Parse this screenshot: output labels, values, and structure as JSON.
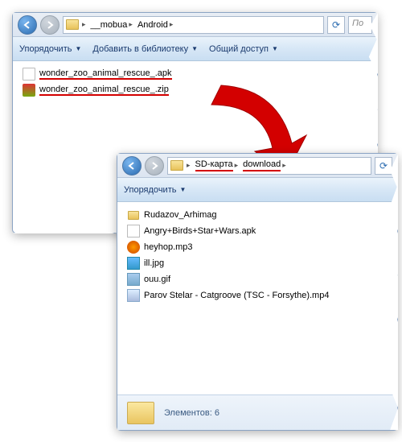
{
  "win1": {
    "breadcrumbs": {
      "a": "__mobua",
      "b": "Android"
    },
    "search_placeholder": "По",
    "toolbar": {
      "organize": "Упорядочить",
      "addlib": "Добавить в библиотеку",
      "share": "Общий доступ"
    },
    "files": {
      "f1": "wonder_zoo_animal_rescue_.apk",
      "f2": "wonder_zoo_animal_rescue_.zip"
    }
  },
  "win2": {
    "breadcrumbs": {
      "a": "SD-карта",
      "b": "download"
    },
    "toolbar": {
      "organize": "Упорядочить"
    },
    "files": {
      "f1": "Rudazov_Arhimag",
      "f2": "Angry+Birds+Star+Wars.apk",
      "f3": "heyhop.mp3",
      "f4": "ill.jpg",
      "f5": "ouu.gif",
      "f6": "Parov Stelar - Catgroove (TSC - Forsythe).mp4"
    },
    "status": {
      "label": "Элементов: 6"
    }
  }
}
